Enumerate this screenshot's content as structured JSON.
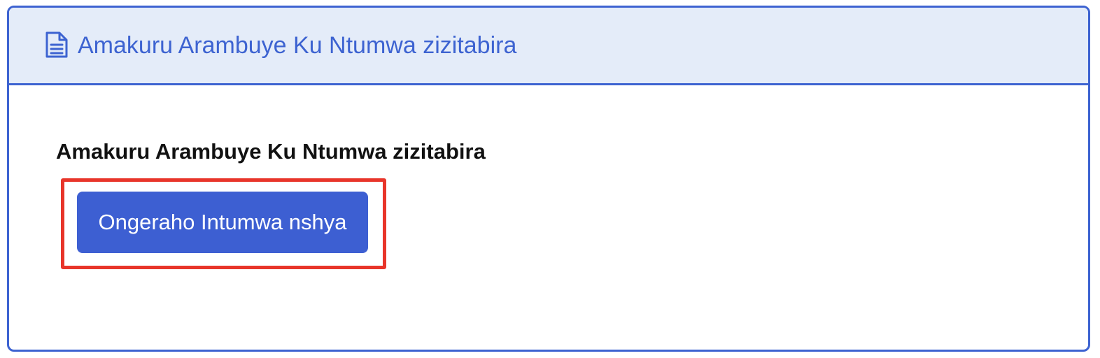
{
  "card": {
    "header": {
      "icon": "document-icon",
      "title": "Amakuru Arambuye Ku Ntumwa zizitabira"
    },
    "body": {
      "title": "Amakuru Arambuye Ku Ntumwa zizitabira",
      "add_button_label": "Ongeraho Intumwa nshya"
    }
  },
  "colors": {
    "accent": "#3d63d1",
    "header_background": "#e4ecf9",
    "button_background": "#3d5fd2",
    "highlight": "#e8352a"
  }
}
